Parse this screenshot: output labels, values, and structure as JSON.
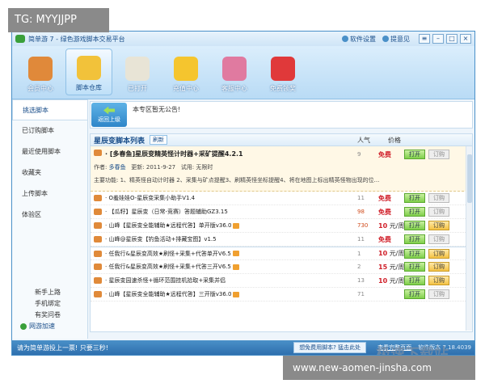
{
  "watermarks": {
    "top_left": "TG: MYYJJPP",
    "bottom_right": "www.new-aomen-jinsha.com",
    "brand": "极速下载站"
  },
  "window": {
    "title": "简单游 7 - 绿色游戏脚本交易平台",
    "links": {
      "settings": "软件设置",
      "feedback": "提意见"
    },
    "controls": [
      "≡",
      "–",
      "□",
      "×"
    ]
  },
  "toolbar": {
    "items": [
      {
        "label": "会员中心",
        "icon": "members-icon",
        "color": "#e0893a"
      },
      {
        "label": "脚本仓库",
        "icon": "warehouse-icon",
        "color": "#f2c23a"
      },
      {
        "label": "已打开",
        "icon": "opened-icon",
        "color": "#e8e4d6"
      },
      {
        "label": "充值中心",
        "icon": "recharge-icon",
        "color": "#f5c52e"
      },
      {
        "label": "客服中心",
        "icon": "support-icon",
        "color": "#e07aa0"
      },
      {
        "label": "免费领奖",
        "icon": "gift-icon",
        "color": "#e0393a"
      }
    ]
  },
  "sidebar": {
    "items": [
      "挑选脚本",
      "已订购脚本",
      "最近使用脚本",
      "收藏夹",
      "上传脚本",
      "体验区"
    ],
    "bottom": [
      "新手上路",
      "手机绑定",
      "有奖问卷"
    ],
    "tip": "网游加速"
  },
  "notice": {
    "back_label": "返回上级",
    "text": "本专区暂无公告!"
  },
  "list": {
    "title": "星辰变脚本列表",
    "refresh": "刷新",
    "col_popularity": "人气",
    "col_price": "价格",
    "open_label": "打开",
    "subscribe_label": "订购",
    "featured": {
      "name": "· [多春鱼]星辰变精英怪计时器+采矿提醒4.2.1",
      "author_label": "作者:",
      "author": "多春鱼",
      "updated_label": "更新:",
      "updated": "2011-9-27",
      "trial_label": "试用:",
      "trial": "无限时",
      "desc": "主要功能: 1、精英怪自动计时器 2、采集与矿点提醒3、刷精英怪坐标提醒4、将在地图上标出精英怪物出现的位...",
      "popularity": "9",
      "price": "免费"
    },
    "rows": [
      {
        "name": "· O羞娃娃O-星辰变采集小助手V1.4",
        "popularity": "11",
        "price": "免费",
        "paid": false,
        "vip": false,
        "sub_on": false
      },
      {
        "name": "· 【瓜籽】星辰变（日常-竞赛）答题辅助GZ3.15",
        "popularity": "98",
        "price": "免费",
        "paid": false,
        "vip": false,
        "sub_on": false,
        "hot": true
      },
      {
        "name": "· 山峰【星辰变全能辅助★远程代答】单开版v36.0",
        "popularity": "730",
        "price_num": "10",
        "price_unit": "元/周",
        "paid": true,
        "vip": true,
        "sub_on": true,
        "hot": true
      },
      {
        "name": "· 山峰@星辰变【钓鱼活动+排藏宝图】v1.5",
        "popularity": "11",
        "price": "免费",
        "paid": false,
        "vip": false,
        "sub_on": false
      },
      {
        "name": "· 任我行&星辰变高效★刷怪+采集+代答单开V6.5",
        "popularity": "1",
        "price_num": "10",
        "price_unit": "元/周",
        "paid": true,
        "vip": true,
        "sub_on": true,
        "sep": true
      },
      {
        "name": "· 任我行&星辰变高效★刷怪+采集+代答三开V6.5",
        "popularity": "2",
        "price_num": "15",
        "price_unit": "元/周",
        "paid": true,
        "vip": true,
        "sub_on": true
      },
      {
        "name": "· 星辰变园速杀怪+循环范围挂机拾取+采集并侣",
        "popularity": "13",
        "price_num": "10",
        "price_unit": "元/周",
        "paid": true,
        "vip": false,
        "sub_on": true
      },
      {
        "name": "· 山峰【星辰变全能辅助★远程代答】三开版v36.0",
        "popularity": "71",
        "price_num": "",
        "price_unit": "",
        "paid": true,
        "vip": true,
        "sub_on": false
      }
    ]
  },
  "statusbar": {
    "message": "请为简单游投上一票! 只要三秒!",
    "ad": "想免费用脚本? 猛击此处",
    "details_link": "查看完整页面",
    "version": "软件版本 7.18.4039"
  }
}
